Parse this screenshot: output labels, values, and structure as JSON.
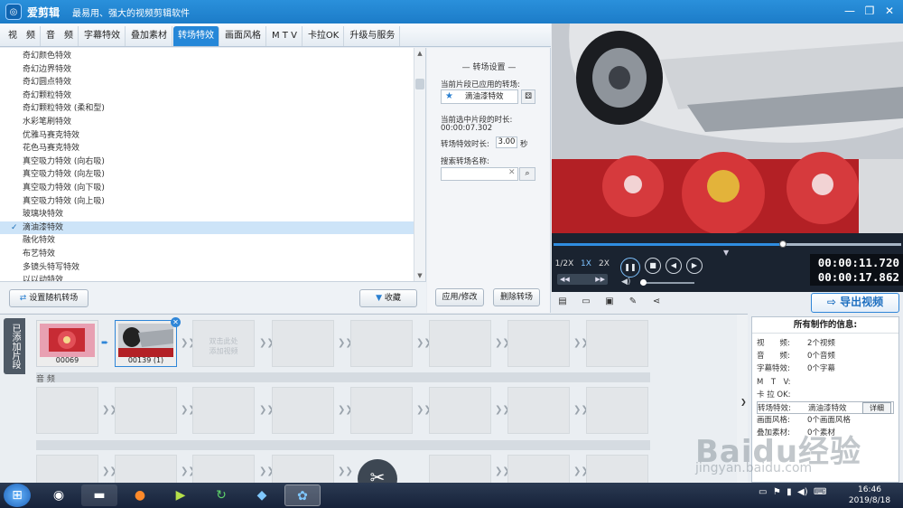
{
  "app": {
    "title": "爱剪辑",
    "subtitle": "最易用、强大的视频剪辑软件"
  },
  "window_controls": {
    "minimize": "—",
    "restore": "❐",
    "close": "✕"
  },
  "tabs": [
    {
      "label": "视　频",
      "active": false
    },
    {
      "label": "音　频",
      "active": false
    },
    {
      "label": "字幕特效",
      "active": false
    },
    {
      "label": "叠加素材",
      "active": false
    },
    {
      "label": "转场特效",
      "active": true
    },
    {
      "label": "画面风格",
      "active": false
    },
    {
      "label": "M T V",
      "active": false
    },
    {
      "label": "卡拉OK",
      "active": false
    },
    {
      "label": "升级与服务",
      "active": false
    }
  ],
  "effects": {
    "items": [
      "奇幻颜色特效",
      "奇幻边界特效",
      "奇幻圆点特效",
      "奇幻颗粒特效",
      "奇幻颗粒特效 (柔和型)",
      "水彩笔刷特效",
      "优雅马赛克特效",
      "花色马赛克特效",
      "真空吸力特效 (向右吸)",
      "真空吸力特效 (向左吸)",
      "真空吸力特效 (向下吸)",
      "真空吸力特效 (向上吸)",
      "玻璃块特效",
      "滴油漆特效",
      "融化特效",
      "布艺特效",
      "多镜头特写特效",
      "以以动特效"
    ],
    "selected_index": 13,
    "check_mark": "✓"
  },
  "list_buttons": {
    "random": "设置随机转场",
    "favorite": "收藏"
  },
  "settings": {
    "title": "转场设置",
    "applied_label": "当前片段已应用的转场:",
    "applied_value": "滴油漆特效",
    "duration_label": "当前选中片段的时长:",
    "duration_value": "00:00:07.302",
    "effect_duration_label": "转场特效时长:",
    "effect_duration_value": "3.00",
    "seconds_unit": "秒",
    "search_label": "搜索转场名称:",
    "search_value": "",
    "apply_button": "应用/修改",
    "delete_button": "删除转场"
  },
  "player": {
    "progress": 0.66,
    "speeds": [
      "1/2X",
      "1X",
      "2X"
    ],
    "active_speed": "1X",
    "current_time": "00:00:11.720",
    "total_time": "00:00:17.862",
    "export_label": "导出视频"
  },
  "timeline": {
    "side_tab": "已添加片段",
    "clips": [
      {
        "label": "00069"
      },
      {
        "label": "00139 (1)"
      }
    ],
    "add_hint": "双击此处\n添加视频",
    "audio_label": "音 频"
  },
  "info": {
    "title": "所有制作的信息:",
    "rows": [
      {
        "key": "视　　频:",
        "value": "2个视频"
      },
      {
        "key": "音　　频:",
        "value": "0个音频"
      },
      {
        "key": "字幕特效:",
        "value": "0个字幕"
      },
      {
        "key": "M　T　V:",
        "value": ""
      },
      {
        "key": "卡 拉 OK:",
        "value": ""
      },
      {
        "key": "转场特效:",
        "value": "滴油漆特效"
      },
      {
        "key": "画面风格:",
        "value": "0个画面风格"
      },
      {
        "key": "叠加素材:",
        "value": "0个素材"
      }
    ],
    "detail_button": "详细"
  },
  "watermark": {
    "brand": "Baidu经验",
    "url": "jingyan.baidu.com"
  },
  "taskbar": {
    "time": "16:46",
    "date": "2019/8/18"
  },
  "colors": {
    "accent": "#2587d8",
    "title_bar": "#1c7cc8",
    "selected_row": "#cde4f8",
    "player_bg": "#1a2330"
  }
}
